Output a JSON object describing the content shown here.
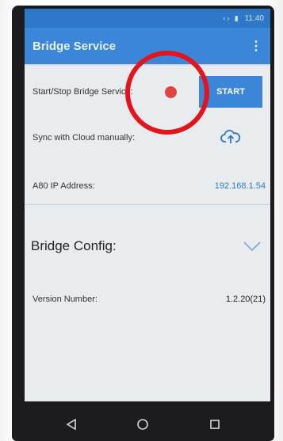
{
  "statusbar": {
    "icons": "‹› ▮",
    "time": "11:40"
  },
  "appbar": {
    "title": "Bridge Service",
    "menu_icon": "overflow-menu-icon"
  },
  "service": {
    "label": "Start/Stop Bridge Service:",
    "status_color": "#e0443c",
    "start_label": "START"
  },
  "sync": {
    "label": "Sync with Cloud manually:",
    "icon": "cloud-upload-icon"
  },
  "ip": {
    "label": "A80 IP Address:",
    "value": "192.168.1.54"
  },
  "config": {
    "label": "Bridge Config:",
    "icon": "chevron-down-icon"
  },
  "version": {
    "label": "Version Number:",
    "value": "1.2.20(21)"
  },
  "navbar": {
    "back_icon": "back-icon",
    "home_icon": "home-icon",
    "recents_icon": "recents-icon"
  },
  "colors": {
    "primary": "#3b86d8",
    "status_bar": "#2f77c8",
    "annotation": "#e3141b"
  }
}
